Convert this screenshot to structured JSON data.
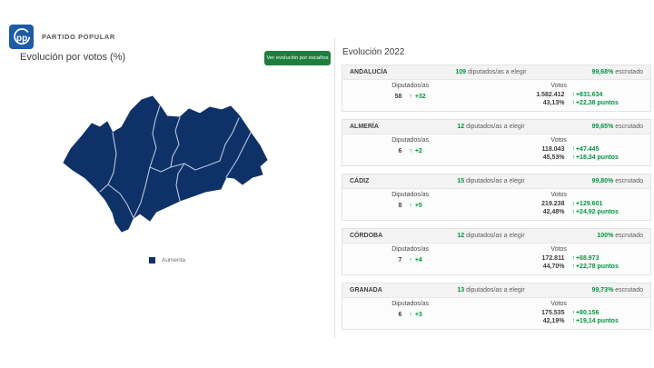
{
  "header": {
    "logo_letters": "pp",
    "brand": "PARTIDO POPULAR",
    "page_title": "Evolución por votos (%)",
    "toggle_button_label": "Ver evolución por escaños"
  },
  "map": {
    "region": "Andalucía",
    "legend": {
      "label": "Aumenta",
      "color": "#0e3167"
    }
  },
  "colors": {
    "map_fill": "#0e3167",
    "map_border": "#b6c8e2",
    "accent_green": "#009640",
    "button_green": "#1e7e3e",
    "logo_blue": "#1d5ba5"
  },
  "panel": {
    "title": "Evolución 2022",
    "arrow": "↑",
    "labels": {
      "seats_suffix": "diputados/as a elegir",
      "scrutiny_suffix": "escrutado",
      "deputies": "Diputados/as",
      "votes": "Votos"
    },
    "cards": [
      {
        "name": "ANDALUCÍA",
        "seats_total": "109",
        "scrutiny": "99,68%",
        "deputies": "58",
        "deputies_delta": "+32",
        "votes": "1.582.412",
        "votes_delta": "+831.634",
        "votes_pct": "43,13%",
        "votes_pct_delta": "+22,38 puntos"
      },
      {
        "name": "ALMERÍA",
        "seats_total": "12",
        "scrutiny": "99,65%",
        "deputies": "6",
        "deputies_delta": "+2",
        "votes": "118.043",
        "votes_delta": "+47.445",
        "votes_pct": "45,53%",
        "votes_pct_delta": "+18,34 puntos"
      },
      {
        "name": "CÁDIZ",
        "seats_total": "15",
        "scrutiny": "99,80%",
        "deputies": "8",
        "deputies_delta": "+5",
        "votes": "219.238",
        "votes_delta": "+129.601",
        "votes_pct": "42,48%",
        "votes_pct_delta": "+24,92 puntos"
      },
      {
        "name": "CÓRDOBA",
        "seats_total": "12",
        "scrutiny": "100%",
        "deputies": "7",
        "deputies_delta": "+4",
        "votes": "172.811",
        "votes_delta": "+88.973",
        "votes_pct": "44,70%",
        "votes_pct_delta": "+22,78 puntos"
      },
      {
        "name": "GRANADA",
        "seats_total": "13",
        "scrutiny": "99,73%",
        "deputies": "6",
        "deputies_delta": "+3",
        "votes": "175.535",
        "votes_delta": "+80.156",
        "votes_pct": "42,19%",
        "votes_pct_delta": "+19,14 puntos"
      }
    ]
  }
}
